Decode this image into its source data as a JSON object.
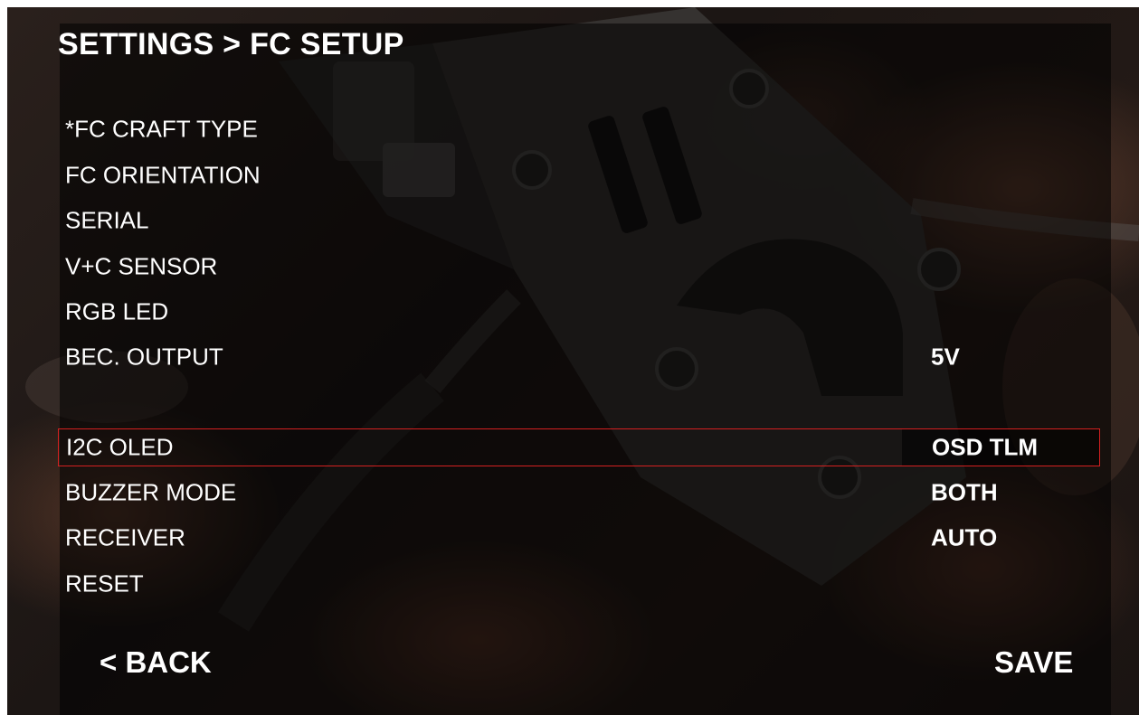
{
  "header": {
    "title": "SETTINGS > FC SETUP"
  },
  "menu": {
    "items": [
      {
        "label": "*FC CRAFT TYPE",
        "value": ""
      },
      {
        "label": "FC ORIENTATION",
        "value": ""
      },
      {
        "label": "SERIAL",
        "value": ""
      },
      {
        "label": "V+C SENSOR",
        "value": ""
      },
      {
        "label": "RGB LED",
        "value": ""
      },
      {
        "label": "BEC. OUTPUT",
        "value": "5V"
      },
      {
        "label": "I2C OLED",
        "value": "OSD TLM",
        "selected": true
      },
      {
        "label": "BUZZER MODE",
        "value": "BOTH"
      },
      {
        "label": "RECEIVER",
        "value": "AUTO"
      },
      {
        "label": "RESET",
        "value": ""
      }
    ]
  },
  "footer": {
    "back_label": "< BACK",
    "save_label": "SAVE"
  },
  "colors": {
    "text": "#ffffff",
    "selection_border": "#d42020",
    "overlay": "#000000"
  }
}
